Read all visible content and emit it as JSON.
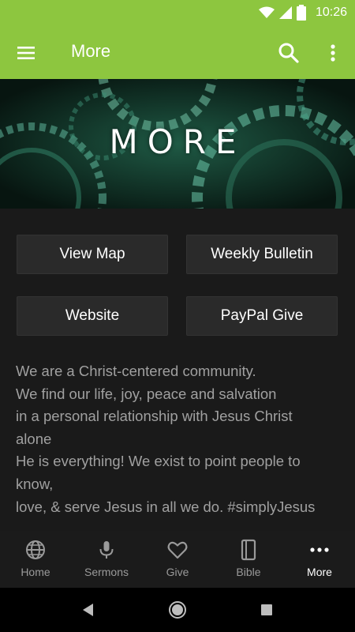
{
  "status": {
    "time": "10:26"
  },
  "appbar": {
    "title": "More"
  },
  "banner": {
    "heading": "MORE"
  },
  "buttons": {
    "view_map": "View Map",
    "weekly_bulletin": "Weekly Bulletin",
    "website": "Website",
    "paypal_give": "PayPal Give"
  },
  "about": {
    "lines": [
      "We are a Christ-centered community.",
      "We find our life, joy, peace and salvation",
      "in a personal relationship with Jesus Christ",
      "alone",
      "He is everything! We exist to point people to",
      "know,",
      "love, & serve Jesus in all we do. #simplyJesus"
    ]
  },
  "bottom_nav": {
    "items": [
      {
        "label": "Home",
        "icon": "globe-icon"
      },
      {
        "label": "Sermons",
        "icon": "microphone-icon"
      },
      {
        "label": "Give",
        "icon": "heart-icon"
      },
      {
        "label": "Bible",
        "icon": "book-icon"
      },
      {
        "label": "More",
        "icon": "more-dots-icon"
      }
    ],
    "active": "More"
  },
  "colors": {
    "accent": "#8dc63f",
    "background": "#1a1a1a",
    "button": "#2a2a2a",
    "text_muted": "#a0a0a0"
  }
}
